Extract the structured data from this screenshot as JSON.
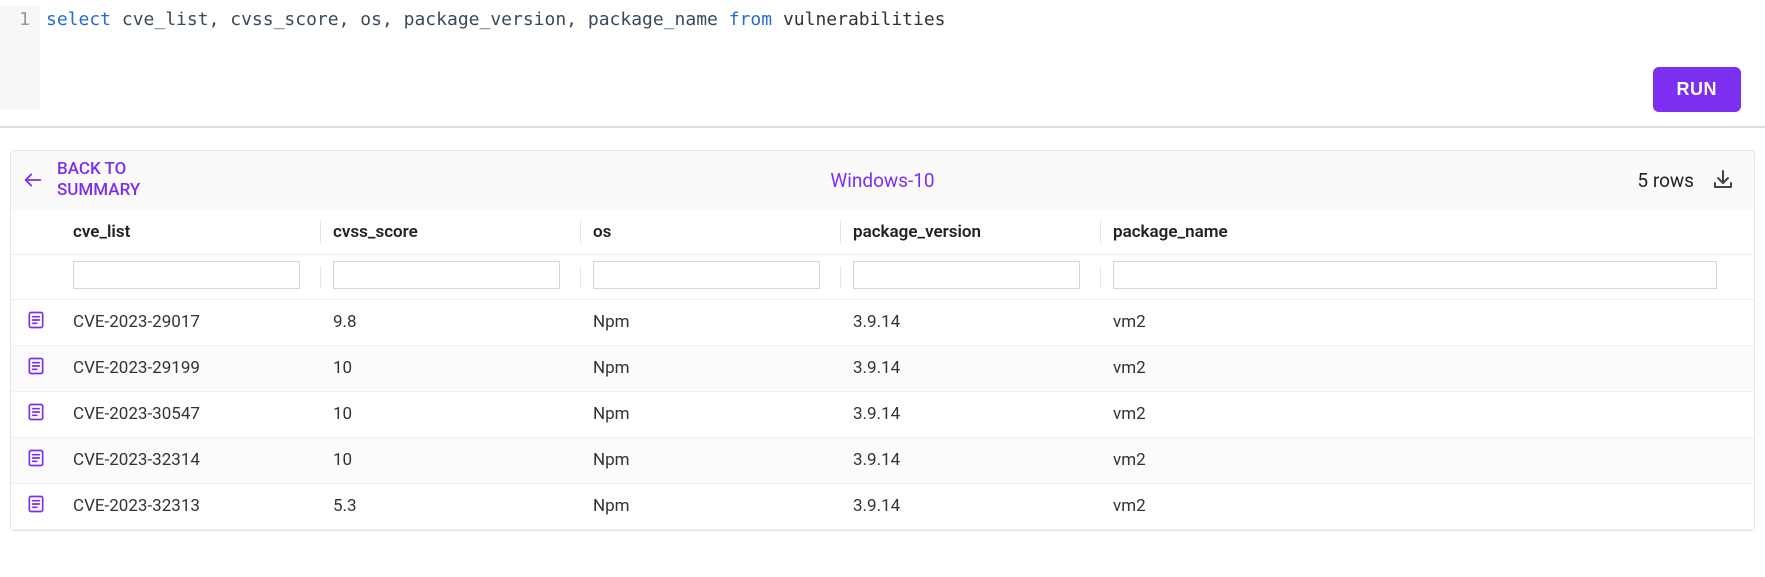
{
  "editor": {
    "line_number": "1",
    "tokens": {
      "select": "select",
      "cols": " cve_list, cvss_score, os, package_version, package_name ",
      "from": "from",
      "table": " vulnerabilities"
    },
    "run_label": "RUN"
  },
  "results": {
    "back_line1": "BACK TO",
    "back_line2": "SUMMARY",
    "title": "Windows-10",
    "row_count_label": "5 rows",
    "columns": [
      "cve_list",
      "cvss_score",
      "os",
      "package_version",
      "package_name"
    ],
    "rows": [
      {
        "cve_list": "CVE-2023-29017",
        "cvss_score": "9.8",
        "os": "Npm",
        "package_version": "3.9.14",
        "package_name": "vm2"
      },
      {
        "cve_list": "CVE-2023-29199",
        "cvss_score": "10",
        "os": "Npm",
        "package_version": "3.9.14",
        "package_name": "vm2"
      },
      {
        "cve_list": "CVE-2023-30547",
        "cvss_score": "10",
        "os": "Npm",
        "package_version": "3.9.14",
        "package_name": "vm2"
      },
      {
        "cve_list": "CVE-2023-32314",
        "cvss_score": "10",
        "os": "Npm",
        "package_version": "3.9.14",
        "package_name": "vm2"
      },
      {
        "cve_list": "CVE-2023-32313",
        "cvss_score": "5.3",
        "os": "Npm",
        "package_version": "3.9.14",
        "package_name": "vm2"
      }
    ]
  }
}
